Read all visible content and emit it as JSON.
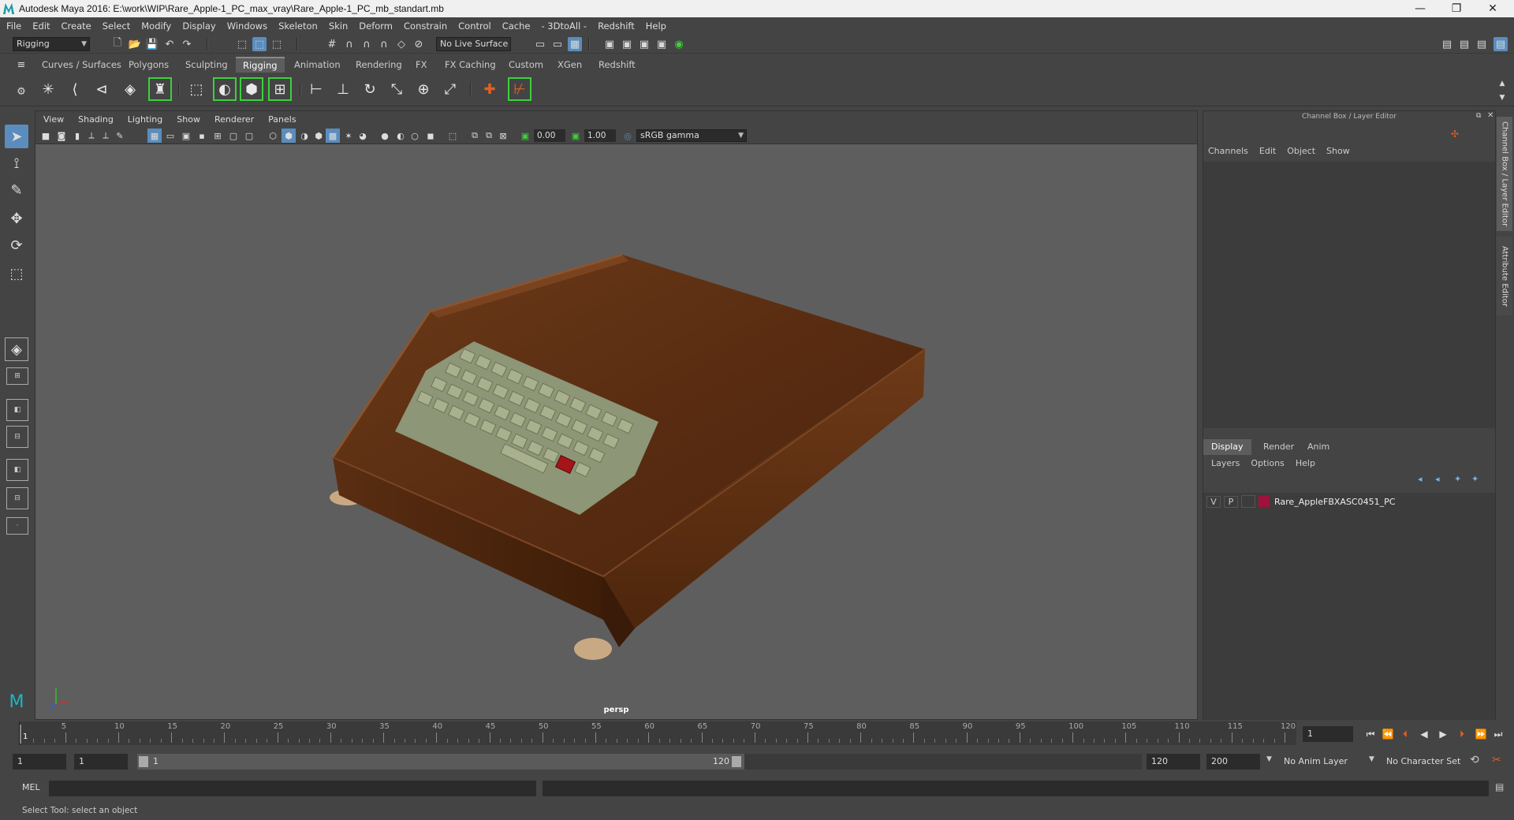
{
  "window": {
    "title": "Autodesk Maya 2016: E:\\work\\WIP\\Rare_Apple-1_PC_max_vray\\Rare_Apple-1_PC_mb_standart.mb",
    "minimize": "—",
    "restore": "❐",
    "close": "✕"
  },
  "menubar": [
    "File",
    "Edit",
    "Create",
    "Select",
    "Modify",
    "Display",
    "Windows",
    "Skeleton",
    "Skin",
    "Deform",
    "Constrain",
    "Control",
    "Cache",
    "- 3DtoAll -",
    "Redshift",
    "Help"
  ],
  "statusline": {
    "mode": "Rigging",
    "live_surface": "No Live Surface"
  },
  "shelf_tabs": [
    {
      "label": "Curves / Surfaces",
      "active": false
    },
    {
      "label": "Polygons",
      "active": false
    },
    {
      "label": "Sculpting",
      "active": false
    },
    {
      "label": "Rigging",
      "active": true
    },
    {
      "label": "Animation",
      "active": false
    },
    {
      "label": "Rendering",
      "active": false
    },
    {
      "label": "FX",
      "active": false
    },
    {
      "label": "FX Caching",
      "active": false
    },
    {
      "label": "Custom",
      "active": false
    },
    {
      "label": "XGen",
      "active": false
    },
    {
      "label": "Redshift",
      "active": false
    }
  ],
  "viewport": {
    "menu": [
      "View",
      "Shading",
      "Lighting",
      "Show",
      "Renderer",
      "Panels"
    ],
    "exposure": "0.00",
    "gamma": "1.00",
    "color_space": "sRGB gamma",
    "camera_label": "persp"
  },
  "channel_box": {
    "title": "Channel Box / Layer Editor",
    "menu": [
      "Channels",
      "Edit",
      "Object",
      "Show"
    ],
    "layer_tabs": [
      {
        "label": "Display",
        "active": true
      },
      {
        "label": "Render",
        "active": false
      },
      {
        "label": "Anim",
        "active": false
      }
    ],
    "layer_menu": [
      "Layers",
      "Options",
      "Help"
    ],
    "layers": [
      {
        "v": "V",
        "p": "P",
        "color": "#a0123a",
        "name": "Rare_AppleFBXASC0451_PC"
      }
    ]
  },
  "side_tabs": [
    "Channel Box / Layer Editor",
    "Attribute Editor"
  ],
  "timeline": {
    "start_frame": "1",
    "ticks": [
      5,
      10,
      15,
      20,
      25,
      30,
      35,
      40,
      45,
      50,
      55,
      60,
      65,
      70,
      75,
      80,
      85,
      90,
      95,
      100,
      105,
      110,
      115,
      120
    ],
    "first_label": "1",
    "current_frame": "1"
  },
  "range": {
    "start": "1",
    "playback_start": "1",
    "slider_start": "1",
    "slider_end": "120",
    "playback_end": "120",
    "end": "200",
    "anim_layer": "No Anim Layer",
    "character_set": "No Character Set"
  },
  "command": {
    "lang": "MEL"
  },
  "help_line": "Select Tool: select an object",
  "colors": {
    "accent": "#5a8dbd",
    "viewport_bg": "#5e5e5e",
    "shelf_highlight": "#3bd13b"
  }
}
